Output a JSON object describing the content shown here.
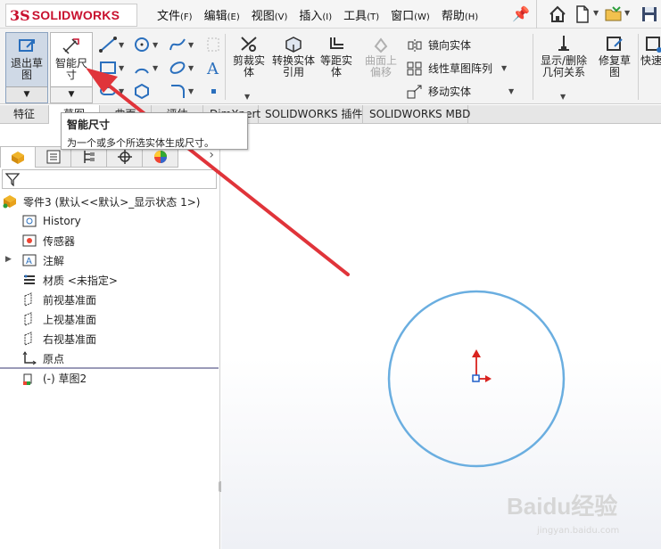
{
  "app": {
    "logo_ds": "3S",
    "logo_text": "SOLIDWORKS",
    "brand_color": "#c8102e"
  },
  "menu": [
    {
      "label": "文件",
      "key": "(F)"
    },
    {
      "label": "编辑",
      "key": "(E)"
    },
    {
      "label": "视图",
      "key": "(V)"
    },
    {
      "label": "插入",
      "key": "(I)"
    },
    {
      "label": "工具",
      "key": "(T)"
    },
    {
      "label": "窗口",
      "key": "(W)"
    },
    {
      "label": "帮助",
      "key": "(H)"
    }
  ],
  "quick_access": [
    "home-icon",
    "new-document-icon",
    "open-folder-icon",
    "save-icon"
  ],
  "ribbon": {
    "exit_sketch_label": "退出草图",
    "smart_dimension_label": "智能尺寸",
    "trim_label": "剪裁实体",
    "convert_label": "转换实体引用",
    "offset_label": "等距实体",
    "surface_offset_label": "曲面上偏移",
    "mirror_label": "镜向实体",
    "linear_pattern_label": "线性草图阵列",
    "move_label": "移动实体",
    "show_delete_relations_label": "显示/删除几何关系",
    "repair_sketch_label": "修复草图",
    "quick_snaps_label": "快速捕"
  },
  "tabs": [
    "特征",
    "草图",
    "曲面",
    "评估",
    "DimXpert",
    "SOLIDWORKS 插件",
    "SOLIDWORKS MBD"
  ],
  "tooltip": {
    "title": "智能尺寸",
    "description": "为一个或多个所选实体生成尺寸。"
  },
  "tree": {
    "root": "零件3 (默认<<默认>_显示状态 1>)",
    "items": [
      {
        "label": "History",
        "icon": "history-icon"
      },
      {
        "label": "传感器",
        "icon": "sensor-icon"
      },
      {
        "label": "注解",
        "icon": "annotation-icon"
      },
      {
        "label": "材质 <未指定>",
        "icon": "material-icon"
      },
      {
        "label": "前视基准面",
        "icon": "plane-icon"
      },
      {
        "label": "上视基准面",
        "icon": "plane-icon"
      },
      {
        "label": "右视基准面",
        "icon": "plane-icon"
      },
      {
        "label": "原点",
        "icon": "origin-icon"
      },
      {
        "label": "(-) 草图2",
        "icon": "sketch-icon"
      }
    ]
  },
  "watermark": {
    "text": "Baidu经验",
    "sub": "jingyan.baidu.com"
  },
  "colors": {
    "circle": "#6aaee0",
    "arrow": "#e0343a",
    "origin_red": "#d9231f",
    "origin_blue": "#1f5fc8"
  }
}
